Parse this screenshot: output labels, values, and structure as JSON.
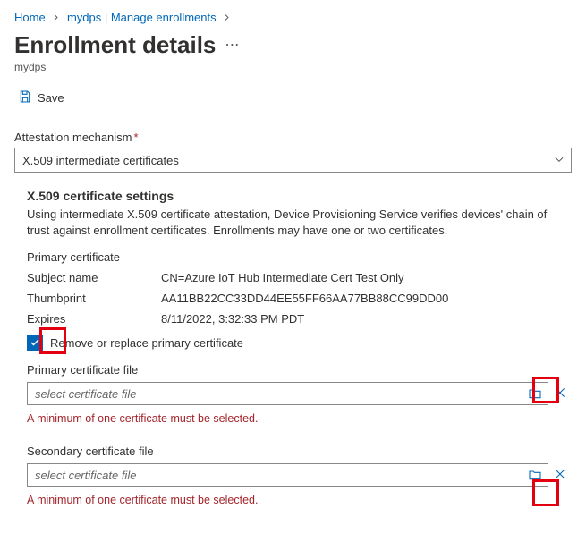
{
  "breadcrumb": {
    "home": "Home",
    "mid": "mydps | Manage enrollments"
  },
  "page": {
    "title": "Enrollment details",
    "subtitle": "mydps"
  },
  "toolbar": {
    "save": "Save"
  },
  "attestation": {
    "label": "Attestation mechanism",
    "value": "X.509 intermediate certificates"
  },
  "x509": {
    "heading": "X.509 certificate settings",
    "desc": "Using intermediate X.509 certificate attestation, Device Provisioning Service verifies devices' chain of trust against enrollment certificates. Enrollments may have one or two certificates.",
    "primary_cert_label": "Primary certificate",
    "rows": {
      "subject_k": "Subject name",
      "subject_v": "CN=Azure IoT Hub Intermediate Cert Test Only",
      "thumb_k": "Thumbprint",
      "thumb_v": "AA11BB22CC33DD44EE55FF66AA77BB88CC99DD00",
      "exp_k": "Expires",
      "exp_v": "8/11/2022, 3:32:33 PM PDT"
    },
    "remove_replace": "Remove or replace primary certificate",
    "primary_file_label": "Primary certificate file",
    "secondary_file_label": "Secondary certificate file",
    "placeholder": "select certificate file",
    "error": "A minimum of one certificate must be selected."
  }
}
